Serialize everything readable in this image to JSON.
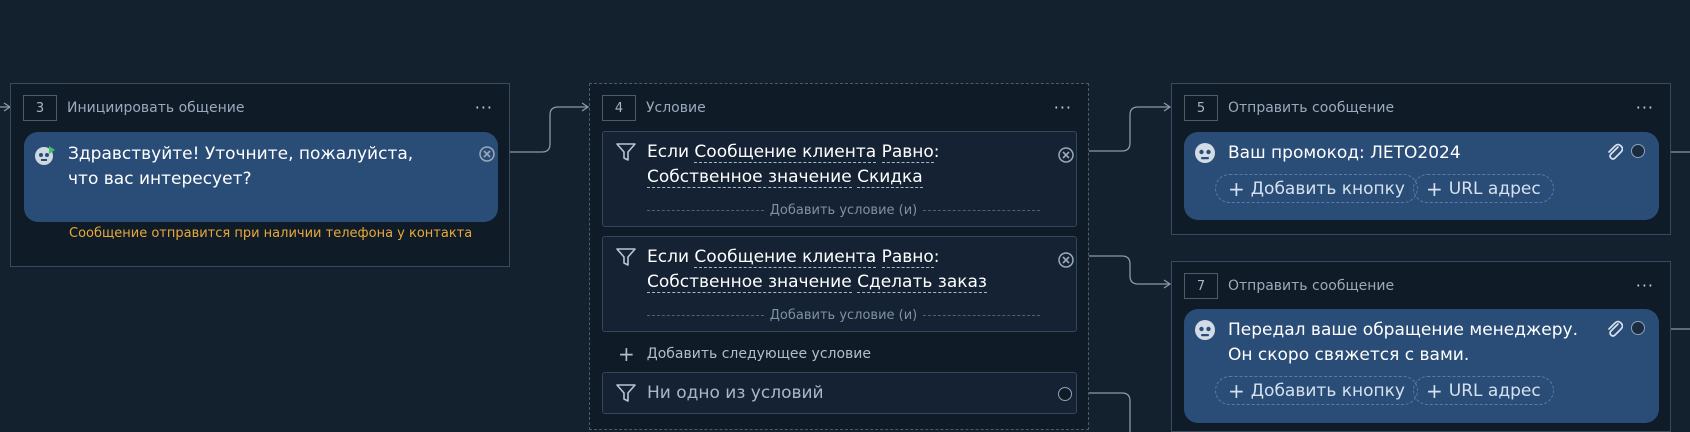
{
  "blocks": {
    "b3": {
      "number": "3",
      "title": "Инициировать общение",
      "menu": "···",
      "message": "Здравствуйте! Уточните, пожалуйста, что вас интересует?",
      "note": "Сообщение отправится при наличии телефона у контакта",
      "icons": {
        "avatar": "bot-avatar-icon",
        "close": "close-circle-icon"
      }
    },
    "b4": {
      "number": "4",
      "title": "Условие",
      "menu": "···",
      "conditions": [
        {
          "if": "Если",
          "field": "Сообщение клиента",
          "operator": "Равно",
          "colon": ":",
          "source": "Собственное значение",
          "value": "Скидка",
          "add_label": "Добавить условие (и)"
        },
        {
          "if": "Если",
          "field": "Сообщение клиента",
          "operator": "Равно",
          "colon": ":",
          "source": "Собственное значение",
          "value": "Сделать заказ",
          "add_label": "Добавить условие (и)"
        }
      ],
      "add_next_label": "Добавить следующее условие",
      "add_next_icon": "+",
      "else_label": "Ни одно из условий",
      "icons": {
        "filter": "filter-icon",
        "close": "close-circle-icon"
      }
    },
    "b5": {
      "number": "5",
      "title": "Отправить сообщение",
      "menu": "···",
      "message": "Ваш промокод: ЛЕТО2024",
      "buttons": [
        {
          "plus": "+",
          "label": "Добавить кнопку"
        },
        {
          "plus": "+",
          "label": "URL адрес"
        }
      ],
      "icons": {
        "avatar": "bot-avatar-icon",
        "attach": "paperclip-icon"
      }
    },
    "b7": {
      "number": "7",
      "title": "Отправить сообщение",
      "menu": "···",
      "message": "Передал ваше обращение менеджеру. Он скоро свяжется с вами.",
      "buttons": [
        {
          "plus": "+",
          "label": "Добавить кнопку"
        },
        {
          "plus": "+",
          "label": "URL адрес"
        }
      ],
      "icons": {
        "avatar": "bot-avatar-icon",
        "attach": "paperclip-icon"
      }
    }
  },
  "colors": {
    "canvas": "#13202e",
    "block_bg": "#0f1b27",
    "message_bg": "#2a4d78",
    "note": "#e8a93a",
    "connector": "#8a98a8"
  }
}
